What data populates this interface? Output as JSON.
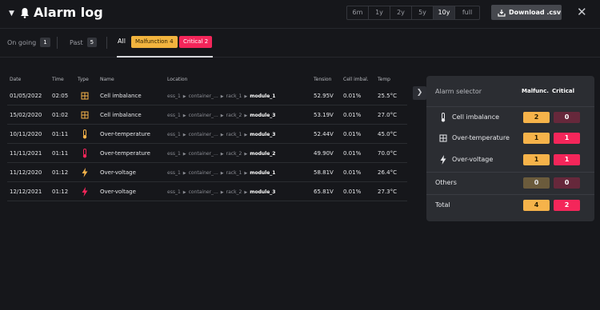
{
  "header": {
    "title": "Alarm log",
    "periods": [
      "6m",
      "1y",
      "2y",
      "5y",
      "10y",
      "full"
    ],
    "active_period": "10y",
    "download_label": "Download .csv",
    "close": "✕"
  },
  "tabs": {
    "ongoing": {
      "label": "On going",
      "count": "1"
    },
    "past": {
      "label": "Past",
      "count": "5"
    },
    "all": {
      "label": "All"
    },
    "malfunction_chip": "Malfunction 4",
    "critical_chip": "Critical 2"
  },
  "table": {
    "headers": [
      "Date",
      "Time",
      "Type",
      "Name",
      "Location",
      "Tension",
      "Cell imbal.",
      "Temp"
    ],
    "rows": [
      {
        "date": "01/05/2022",
        "time": "02:05",
        "type": "cell-imbalance",
        "severity": "malfunction",
        "name": "Cell imbalance",
        "loc": [
          "ess_1",
          "container_...",
          "rack_1",
          "module_1"
        ],
        "tension": "52.95V",
        "cell": "0.01%",
        "temp": "25.5°C"
      },
      {
        "date": "15/02/2020",
        "time": "01:02",
        "type": "cell-imbalance",
        "severity": "malfunction",
        "name": "Cell imbalance",
        "loc": [
          "ess_1",
          "container_...",
          "rack_2",
          "module_3"
        ],
        "tension": "53.19V",
        "cell": "0.01%",
        "temp": "27.0°C"
      },
      {
        "date": "10/11/2020",
        "time": "01:11",
        "type": "over-temperature",
        "severity": "malfunction",
        "name": "Over-temperature",
        "loc": [
          "ess_1",
          "container_...",
          "rack_1",
          "module_3"
        ],
        "tension": "52.44V",
        "cell": "0.01%",
        "temp": "45.0°C"
      },
      {
        "date": "11/11/2021",
        "time": "01:11",
        "type": "over-temperature",
        "severity": "critical",
        "name": "Over-temperature",
        "loc": [
          "ess_1",
          "container_...",
          "rack_2",
          "module_2"
        ],
        "tension": "49.90V",
        "cell": "0.01%",
        "temp": "70.0°C"
      },
      {
        "date": "11/12/2020",
        "time": "01:12",
        "type": "over-voltage",
        "severity": "malfunction",
        "name": "Over-voltage",
        "loc": [
          "ess_1",
          "container_...",
          "rack_1",
          "module_1"
        ],
        "tension": "58.81V",
        "cell": "0.01%",
        "temp": "26.4°C"
      },
      {
        "date": "12/12/2021",
        "time": "01:12",
        "type": "over-voltage",
        "severity": "critical",
        "name": "Over-voltage",
        "loc": [
          "ess_1",
          "container_...",
          "rack_2",
          "module_3"
        ],
        "tension": "65.81V",
        "cell": "0.01%",
        "temp": "27.3°C"
      }
    ]
  },
  "selector": {
    "title": "Alarm selector",
    "col_malfunction": "Malfunc.",
    "col_critical": "Critical",
    "rows": [
      {
        "label": "Cell imbalance",
        "icon": "thermometer-icon",
        "mal": "2",
        "crit": "0"
      },
      {
        "label": "Over-temperature",
        "icon": "grid-icon",
        "mal": "1",
        "crit": "1"
      },
      {
        "label": "Over-voltage",
        "icon": "lightning-icon",
        "mal": "1",
        "crit": "1"
      }
    ],
    "others": {
      "label": "Others",
      "mal": "0",
      "crit": "0"
    },
    "total": {
      "label": "Total",
      "mal": "4",
      "crit": "2"
    }
  },
  "colors": {
    "malfunction": "#f6b34a",
    "critical": "#f4265a",
    "background": "#16171b",
    "panel": "#2b2d32"
  }
}
